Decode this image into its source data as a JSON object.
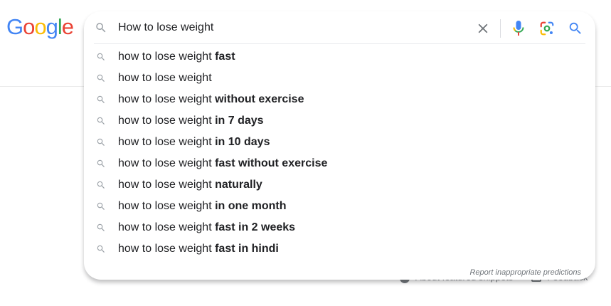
{
  "logo": {
    "letters": [
      "G",
      "o",
      "o",
      "g",
      "l",
      "e"
    ],
    "colors": [
      "#4285F4",
      "#EA4335",
      "#FBBC05",
      "#4285F4",
      "#34A853",
      "#EA4335"
    ]
  },
  "search": {
    "value": "How to lose weight",
    "icons": {
      "lead": "search-icon",
      "clear": "close-icon",
      "voice": "microphone-icon",
      "lens": "google-lens-icon",
      "submit": "search-icon"
    }
  },
  "suggestions": [
    {
      "prefix": "how to lose weight",
      "bold": "fast"
    },
    {
      "prefix": "how to lose weight",
      "bold": ""
    },
    {
      "prefix": "how to lose weight",
      "bold": "without exercise"
    },
    {
      "prefix": "how to lose weight",
      "bold": "in 7 days"
    },
    {
      "prefix": "how to lose weight",
      "bold": "in 10 days"
    },
    {
      "prefix": "how to lose weight",
      "bold": "fast without exercise"
    },
    {
      "prefix": "how to lose weight",
      "bold": "naturally"
    },
    {
      "prefix": "how to lose weight",
      "bold": "in one month"
    },
    {
      "prefix": "how to lose weight",
      "bold": "fast in 2 weeks"
    },
    {
      "prefix": "how to lose weight",
      "bold": "fast in hindi"
    }
  ],
  "footer": {
    "report_label": "Report inappropriate predictions",
    "about_label": "About featured snippets",
    "feedback_label": "Feedback"
  },
  "colors": {
    "icon_grey": "#9aa0a6",
    "blue": "#4285F4",
    "text": "#202124"
  }
}
